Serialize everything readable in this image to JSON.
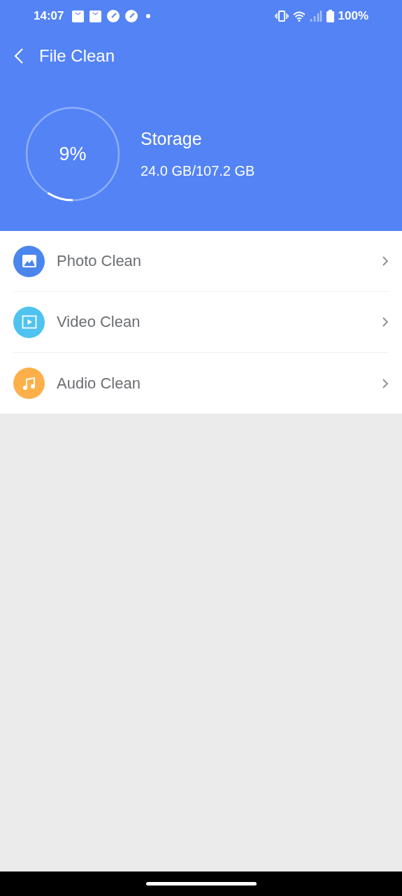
{
  "status_bar": {
    "time": "14:07",
    "battery": "100%"
  },
  "toolbar": {
    "title": "File Clean"
  },
  "storage": {
    "percent": "9%",
    "level": 0.09,
    "label": "Storage",
    "usage": "24.0 GB/107.2 GB"
  },
  "items": [
    {
      "kind": "photo",
      "label": "Photo Clean",
      "color": "#4a86ee"
    },
    {
      "kind": "video",
      "label": "Video Clean",
      "color": "#4fc3ef"
    },
    {
      "kind": "audio",
      "label": "Audio Clean",
      "color": "#fdb04a"
    }
  ]
}
